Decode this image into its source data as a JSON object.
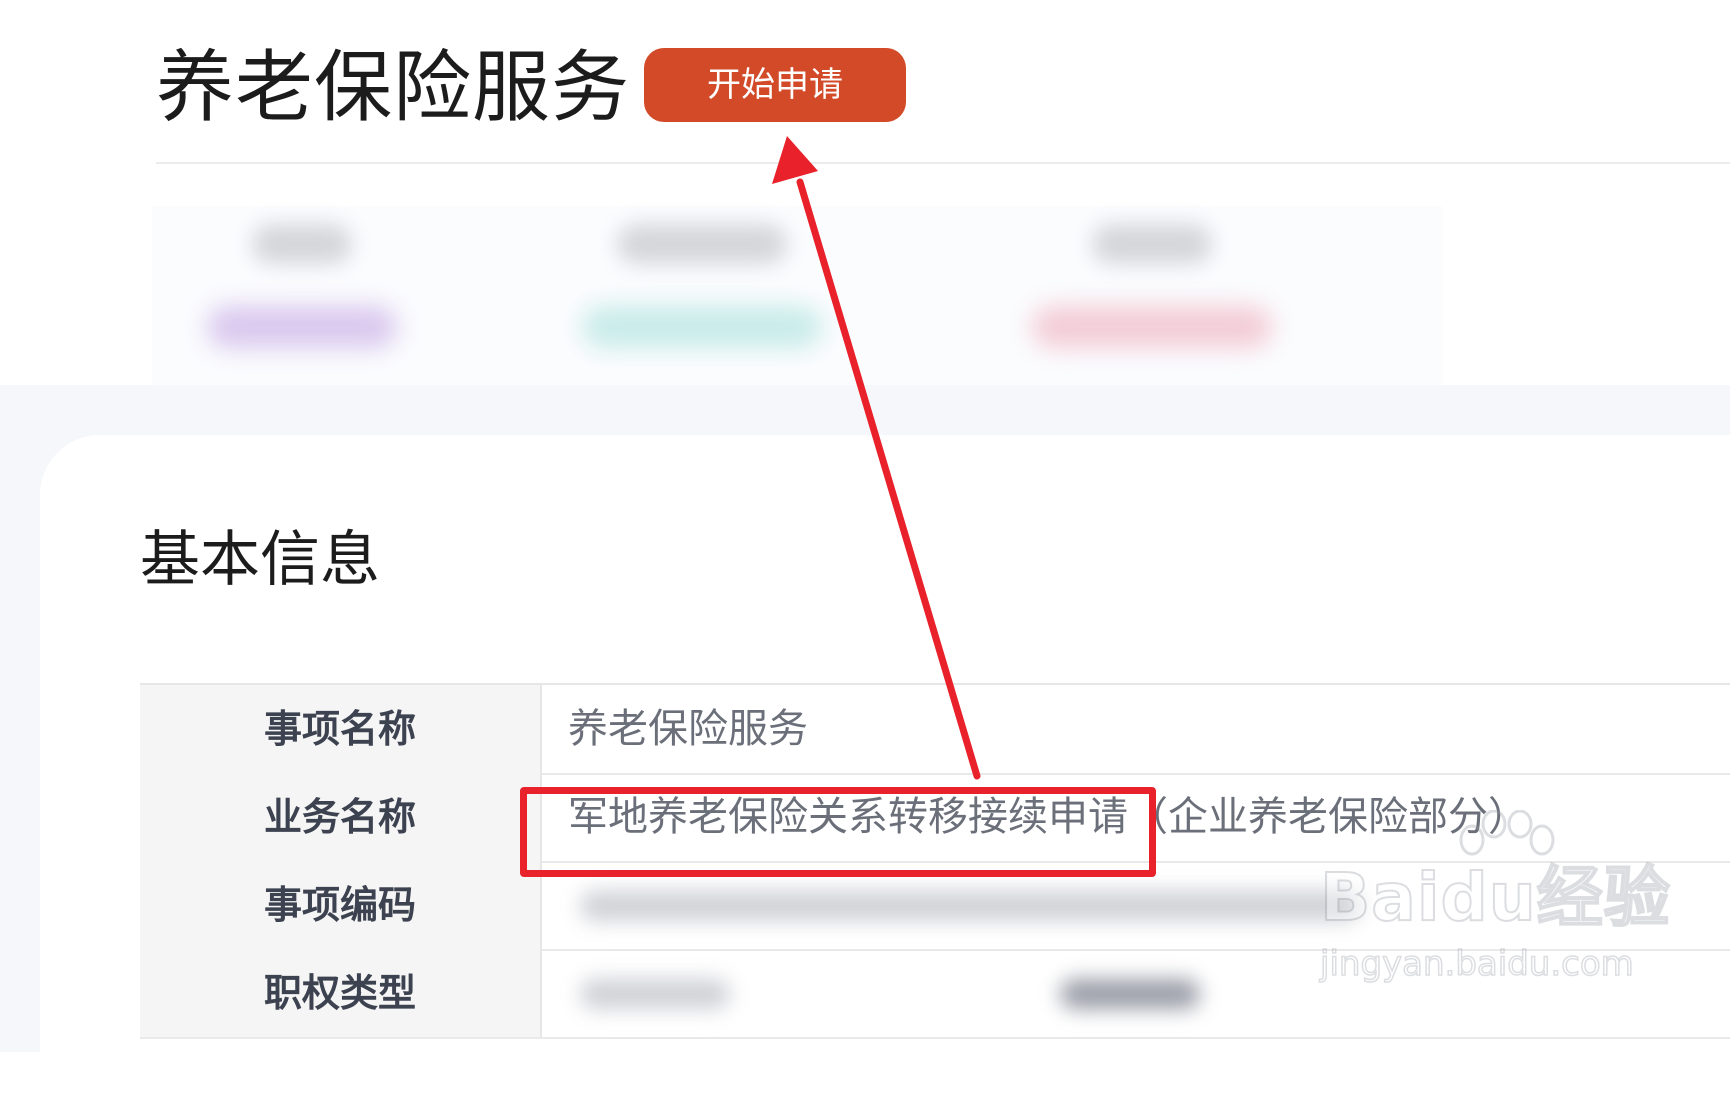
{
  "header": {
    "title": "养老保险服务",
    "apply_button": "开始申请"
  },
  "stats_colors": [
    "#d9c8ee",
    "#c8ebe9",
    "#f3ccd6"
  ],
  "basic_info": {
    "title": "基本信息",
    "rows": [
      {
        "label": "事项名称",
        "value": "养老保险服务"
      },
      {
        "label": "业务名称",
        "value": "军地养老保险关系转移接续申请（企业养老保险部分）"
      },
      {
        "label": "事项编码",
        "value": ""
      },
      {
        "label": "职权类型",
        "value": ""
      }
    ]
  },
  "annotation": {
    "color": "#e8212b"
  },
  "watermark": {
    "logo": "Baidu经验",
    "url": "jingyan.baidu.com"
  }
}
